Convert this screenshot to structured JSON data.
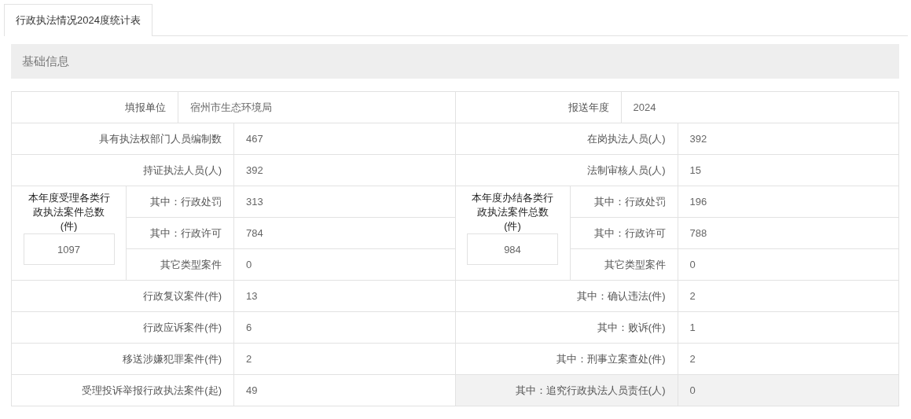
{
  "tab": {
    "label": "行政执法情况2024度统计表",
    "selected": true
  },
  "section": {
    "title": "基础信息"
  },
  "rows": [
    {
      "kind": "header",
      "cells": [
        {
          "label": "填报单位",
          "value": "宿州市生态环境局",
          "highlighted": false
        },
        {
          "label": "报送年度",
          "value": "2024",
          "highlighted": false
        }
      ]
    },
    {
      "kind": "pair",
      "cells": [
        {
          "label": "具有执法权部门人员编制数",
          "value": "467",
          "highlighted": false
        },
        {
          "label": "在岗执法人员(人)",
          "value": "392",
          "highlighted": false
        }
      ]
    },
    {
      "kind": "pair",
      "cells": [
        {
          "label": "持证执法人员(人)",
          "value": "392",
          "highlighted": false
        },
        {
          "label": "法制审核人员(人)",
          "value": "15",
          "highlighted": false
        }
      ]
    },
    {
      "kind": "group",
      "groups": [
        {
          "title": "本年度受理各类行政执法案件总数(件)",
          "total": "1097",
          "items": [
            {
              "label": "其中：行政处罚",
              "value": "313"
            },
            {
              "label": "其中：行政许可",
              "value": "784"
            },
            {
              "label": "其它类型案件",
              "value": "0"
            }
          ]
        },
        {
          "title": "本年度办结各类行政执法案件总数(件)",
          "total": "984",
          "items": [
            {
              "label": "其中：行政处罚",
              "value": "196"
            },
            {
              "label": "其中：行政许可",
              "value": "788"
            },
            {
              "label": "其它类型案件",
              "value": "0"
            }
          ]
        }
      ]
    },
    {
      "kind": "pair",
      "cells": [
        {
          "label": "行政复议案件(件)",
          "value": "13",
          "highlighted": false
        },
        {
          "label": "其中：确认违法(件)",
          "value": "2",
          "highlighted": false
        }
      ]
    },
    {
      "kind": "pair",
      "cells": [
        {
          "label": "行政应诉案件(件)",
          "value": "6",
          "highlighted": false
        },
        {
          "label": "其中：败诉(件)",
          "value": "1",
          "highlighted": false
        }
      ]
    },
    {
      "kind": "pair",
      "cells": [
        {
          "label": "移送涉嫌犯罪案件(件)",
          "value": "2",
          "highlighted": false
        },
        {
          "label": "其中：刑事立案查处(件)",
          "value": "2",
          "highlighted": false
        }
      ]
    },
    {
      "kind": "pair",
      "cells": [
        {
          "label": "受理投诉举报行政执法案件(起)",
          "value": "49",
          "highlighted": false
        },
        {
          "label": "其中：追究行政执法人员责任(人)",
          "value": "0",
          "highlighted": true
        }
      ]
    }
  ]
}
